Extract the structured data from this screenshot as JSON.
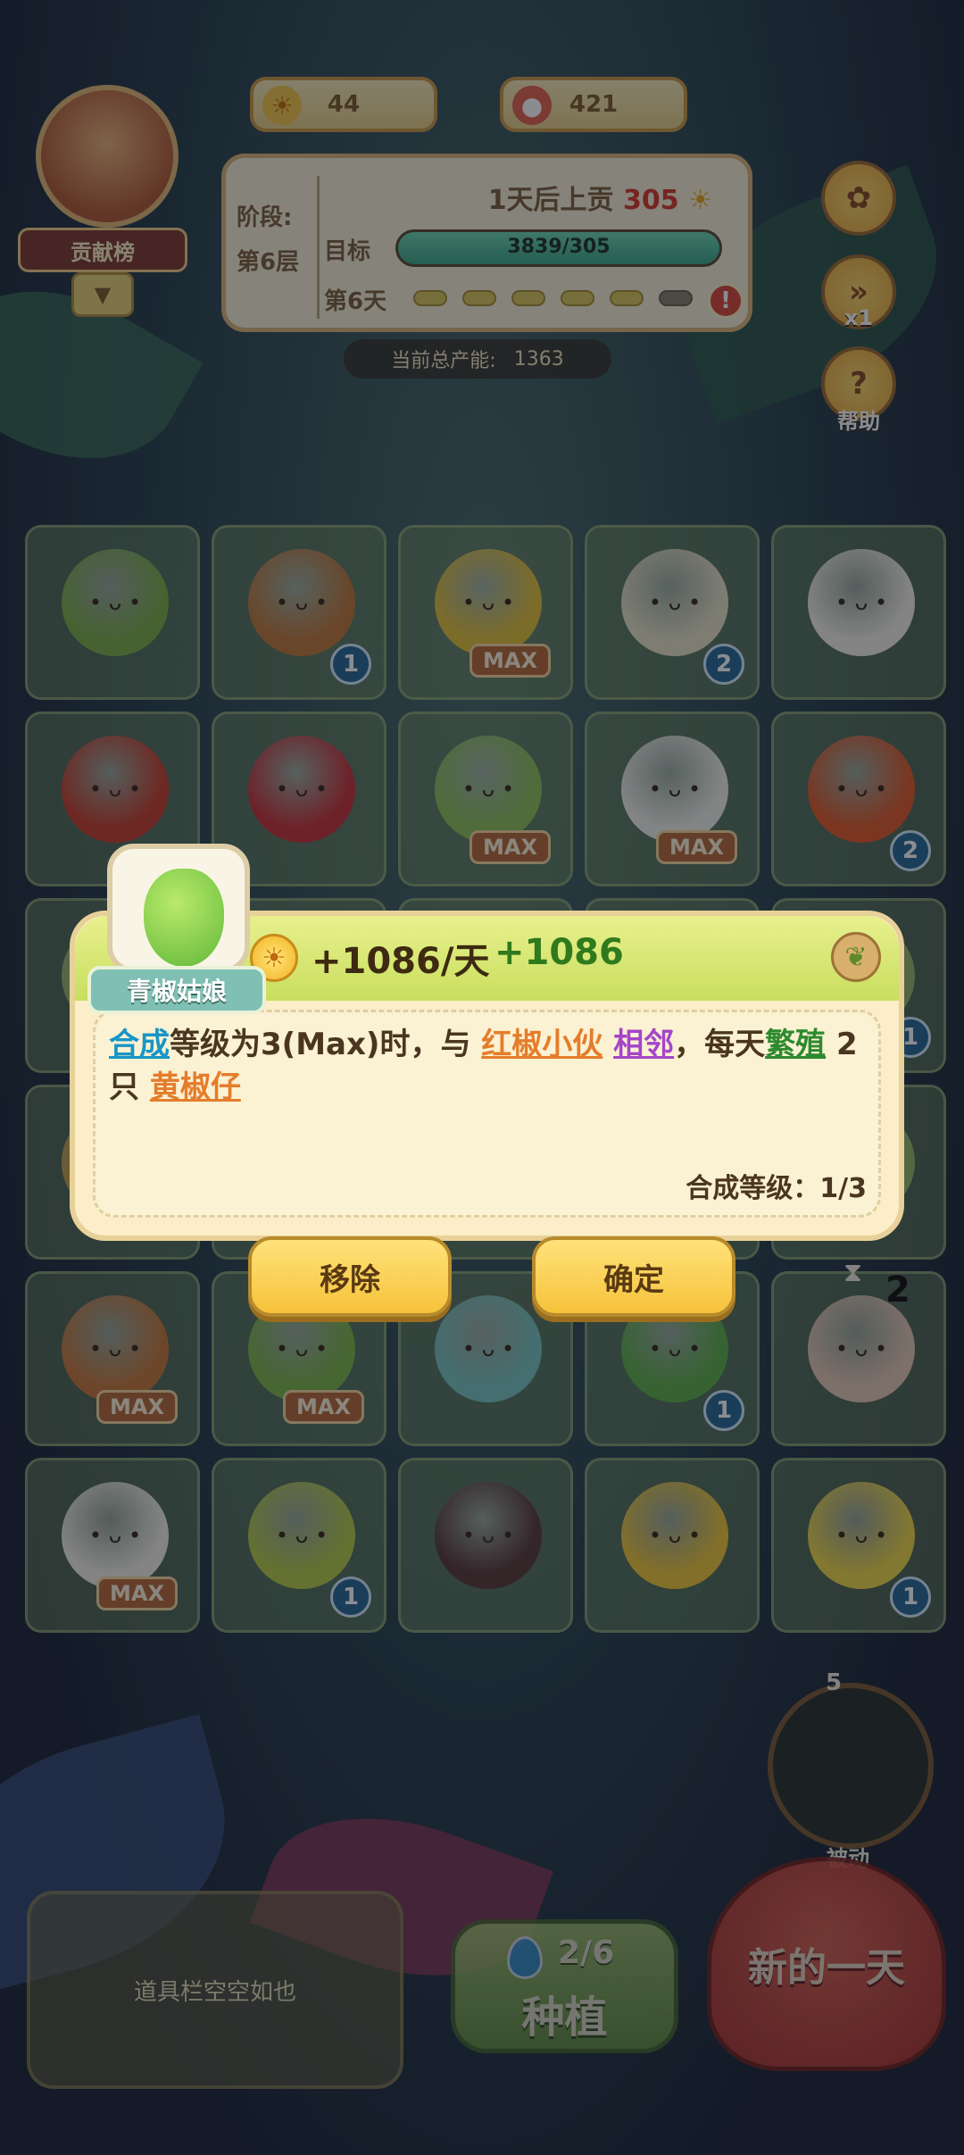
{
  "currency": {
    "sun": "44",
    "mushroom": "421"
  },
  "rank": {
    "label": "贡献榜"
  },
  "stage": {
    "phase_label": "阶段:",
    "floor": "第6层",
    "tribute_prefix": "1天后上贡",
    "tribute_value": "305",
    "target_label": "目标",
    "target_progress": "3839/305",
    "target_fill_fraction": 1.0,
    "day_label": "第6天",
    "days_total": 6,
    "days_done": 5,
    "warning": "!"
  },
  "production": {
    "label": "当前总产能:",
    "value": "1363"
  },
  "side": {
    "speed_label": "x1",
    "help_label": "帮助"
  },
  "grid": {
    "rows": [
      [
        {
          "badge": ""
        },
        {
          "badge": "1"
        },
        {
          "badge": "MAX"
        },
        {
          "badge": "2"
        },
        {
          "badge": ""
        }
      ],
      [
        {
          "badge": ""
        },
        {
          "badge": ""
        },
        {
          "badge": "MAX"
        },
        {
          "badge": "MAX"
        },
        {
          "badge": "2"
        }
      ],
      [
        {
          "badge": ""
        },
        {
          "badge": ""
        },
        {
          "badge": ""
        },
        {
          "badge": ""
        },
        {
          "badge": "1"
        }
      ],
      [
        {
          "badge": ""
        },
        {
          "badge": ""
        },
        {
          "badge": ""
        },
        {
          "badge": ""
        },
        {
          "badge": ""
        }
      ],
      [
        {
          "badge": "MAX"
        },
        {
          "badge": "MAX"
        },
        {
          "badge": ""
        },
        {
          "badge": "1"
        },
        {
          "badge": ""
        }
      ],
      [
        {
          "badge": "MAX"
        },
        {
          "badge": "1"
        },
        {
          "badge": ""
        },
        {
          "badge": ""
        },
        {
          "badge": "1"
        }
      ]
    ],
    "colors": [
      [
        "#7fae4a",
        "#c07a3c",
        "#e5c23a",
        "#e8e2c6",
        "#f2f0e6"
      ],
      [
        "#c9402e",
        "#c8343a",
        "#8fc25a",
        "#f1f0ea",
        "#e05b2b"
      ],
      [
        "#9ab86a",
        "#9ab86a",
        "#9ab86a",
        "#9ab86a",
        "#9ab86a"
      ],
      [
        "#c8a24c",
        "#9ab86a",
        "#9ab86a",
        "#9ab86a",
        "#9ab86a"
      ],
      [
        "#c87a3c",
        "#7eb84a",
        "#7ac6c2",
        "#5fb04a",
        "#e6c8b4"
      ],
      [
        "#f2f0e6",
        "#b6cc4a",
        "#5a3a3a",
        "#f0c83a",
        "#f0d84a"
      ]
    ]
  },
  "hourglass": {
    "count": "2"
  },
  "popup": {
    "name": "青椒姑娘",
    "rate": "+1086/天",
    "bonus": "+1086",
    "desc_parts": [
      {
        "t": "合成",
        "c": "blue"
      },
      {
        "t": "等级为3(Max)时，与 ",
        "c": ""
      },
      {
        "t": "红椒小伙",
        "c": "orange"
      },
      {
        "t": " ",
        "c": ""
      },
      {
        "t": "相邻",
        "c": "purple"
      },
      {
        "t": "，每天",
        "c": ""
      },
      {
        "t": "繁殖",
        "c": "green"
      },
      {
        "t": " 2 只 ",
        "c": ""
      },
      {
        "t": "黄椒仔",
        "c": "orange"
      }
    ],
    "level": "合成等级：1/3",
    "remove_label": "移除",
    "confirm_label": "确定"
  },
  "bottom": {
    "inventory_empty": "道具栏空空如也",
    "water": "2/6",
    "plant_label": "种植",
    "new_day": "新的一天",
    "passive_label": "被动",
    "passive_count": "5"
  }
}
